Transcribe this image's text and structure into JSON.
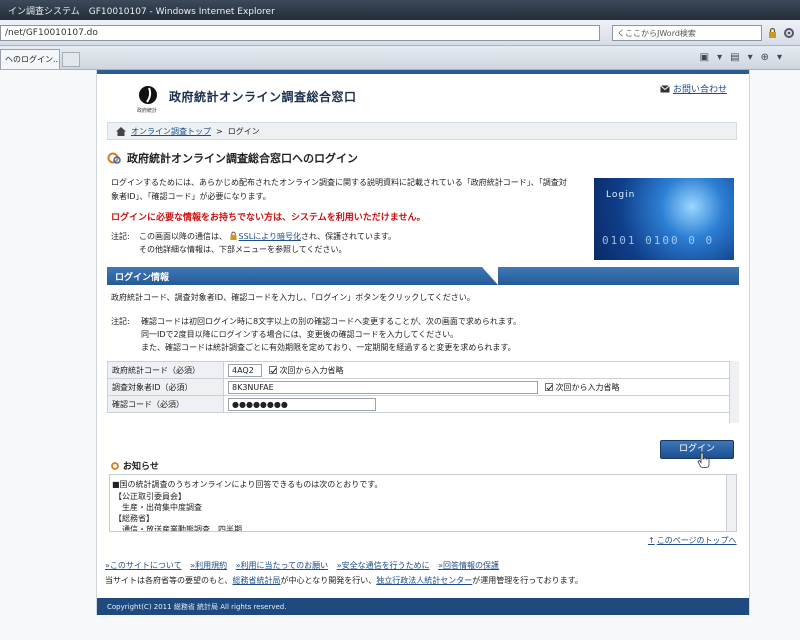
{
  "browser": {
    "title": "イン調査システム　GF10010107 - Windows Internet Explorer",
    "url": "/net/GF10010107.do",
    "search": "くここからJWord検索",
    "tab_label": "ヘのログイン..."
  },
  "header": {
    "logo_sub": "政府統計",
    "title": "政府統計オンライン調査総合窓口",
    "contact": "お問い合わせ"
  },
  "breadcrumb": {
    "home": "オンライン調査トップ",
    "sep": ">",
    "current": "ログイン"
  },
  "page": {
    "heading": "政府統計オンライン調査総合窓口へのログイン",
    "intro": "ログインするためには、あらかじめ配布されたオンライン調査に関する説明資料に記載されている「政府統計コード」、「調査対象者ID」、「確認コード」が必要になります。",
    "warning": "ログインに必要な情報をお持ちでない方は、システムを利用いただけません。",
    "note_label": "注記:",
    "note_line1_a": "この画面以降の通信は、",
    "note_ssl": "SSLにより暗号化",
    "note_line1_b": "され、保護されています。",
    "note_line2": "その他詳細な情報は、下部メニューを参照してください。"
  },
  "banner": {
    "word": "Login",
    "digits": "0101 0100 0 0"
  },
  "login_section": {
    "title": "ログイン情報",
    "instruction": "政府統計コード、調査対象者ID、確認コードを入力し、「ログイン」ボタンをクリックしてください。",
    "note_label": "注記:",
    "note_lines": [
      "確認コードは初回ログイン時に8文字以上の別の確認コードへ変更することが、次の画面で求められます。",
      "同一IDで2度目以降にログインする場合には、変更後の確認コードを入力してください。",
      "また、確認コードは統計調査ごとに有効期限を定めており、一定期間を経過すると変更を求められます。"
    ]
  },
  "form": {
    "code_label": "政府統計コード（必須）",
    "code_value": "4AQ2",
    "remember_label": "次回から入力省略",
    "id_label": "調査対象者ID（必須）",
    "id_value": "8K3NUFAE",
    "remember_label2": "次回から入力省略",
    "pw_label": "確認コード（必須）",
    "pw_value": "●●●●●●●●"
  },
  "login_button": "ログイン",
  "news": {
    "heading": "お知らせ",
    "intro": "■国の統計調査のうちオンラインにより回答できるものは次のとおりです。",
    "lines": [
      "【公正取引委員会】",
      "　生産・出荷集中度調査",
      "【総務省】",
      "　通信・放送産業動態調査　四半期"
    ]
  },
  "top_link": "このページのトップへ",
  "footer": {
    "links": [
      "»このサイトについて",
      "»利用規約",
      "»利用に当たってのお願い",
      "»安全な通信を行うために",
      "»回答情報の保護"
    ],
    "note_a": "当サイトは各府省等の要望のもと、",
    "note_link1": "総務省統計局",
    "note_b": "が中心となり開発を行い、",
    "note_link2": "独立行政法人統計センター",
    "note_c": "が運用管理を行っております。",
    "copyright": "Copyright(C) 2011 総務省 統計局 All rights reserved."
  },
  "colors": {
    "accent": "#2d5c92",
    "warning": "#cc1111",
    "link": "#1d4d8c"
  }
}
